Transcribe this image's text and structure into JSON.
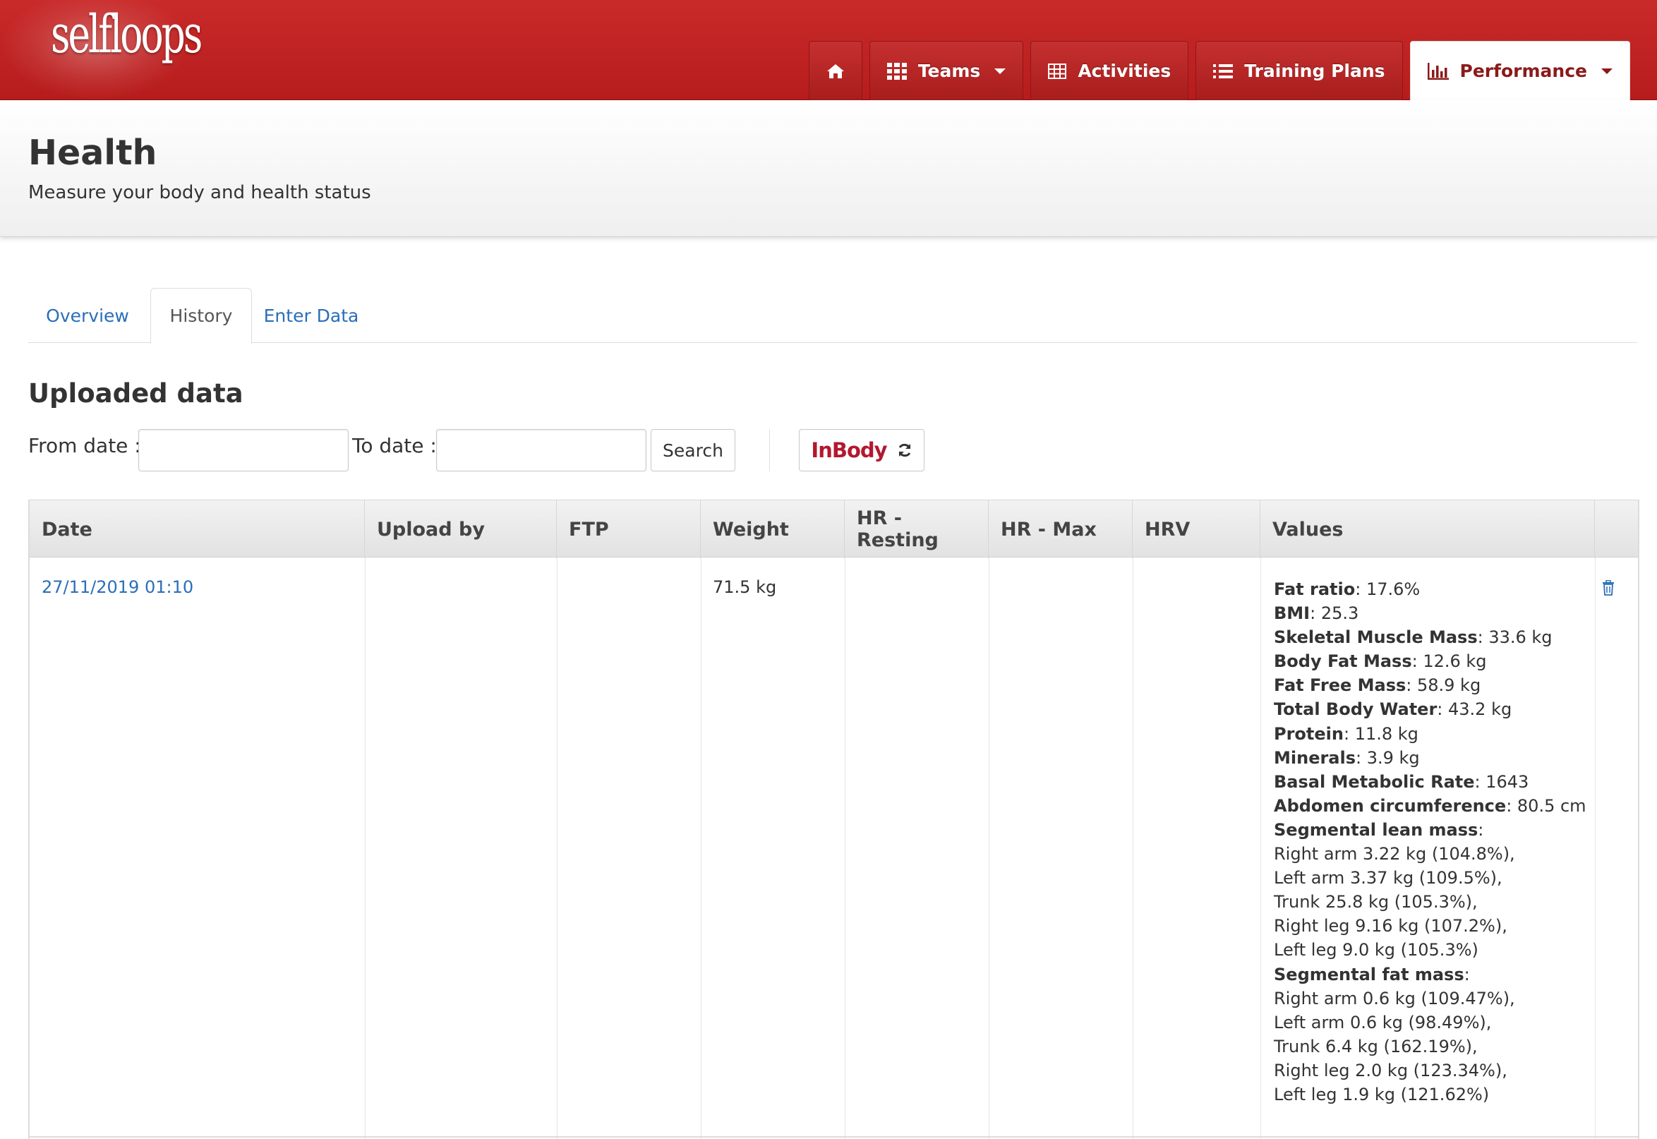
{
  "brand": {
    "logo_text": "selfloops"
  },
  "nav": {
    "home_label": "",
    "items": [
      {
        "label": "Teams",
        "icon": "grid-icon"
      },
      {
        "label": "Activities",
        "icon": "table-icon"
      },
      {
        "label": "Training Plans",
        "icon": "list-icon"
      },
      {
        "label": "Performance",
        "icon": "bar-chart-icon"
      }
    ],
    "active": "Performance",
    "accent_color": "#b71c1c"
  },
  "page": {
    "title": "Health",
    "subtitle": "Measure your body and health status"
  },
  "tabs": [
    {
      "label": "Overview"
    },
    {
      "label": "History"
    },
    {
      "label": "Enter Data"
    }
  ],
  "active_tab": "History",
  "uploaded": {
    "title": "Uploaded data",
    "from_label": "From date :",
    "to_label": "To date :",
    "from_value": "",
    "to_value": "",
    "search_label": "Search",
    "inbody_label": "InBody"
  },
  "table": {
    "headers": [
      "Date",
      "Upload by",
      "FTP",
      "Weight",
      "HR - Resting",
      "HR - Max",
      "HRV",
      "Values",
      ""
    ],
    "rows": [
      {
        "date": "27/11/2019 01:10",
        "upload_by": "",
        "ftp": "",
        "weight": "71.5 kg",
        "hr_resting": "",
        "hr_max": "",
        "hrv": "",
        "values": [
          {
            "key": "Fat ratio",
            "value": ": 17.6%"
          },
          {
            "key": "BMI",
            "value": ": 25.3"
          },
          {
            "key": "Skeletal Muscle Mass",
            "value": ": 33.6 kg"
          },
          {
            "key": "Body Fat Mass",
            "value": ": 12.6 kg"
          },
          {
            "key": "Fat Free Mass",
            "value": ": 58.9 kg"
          },
          {
            "key": "Total Body Water",
            "value": ": 43.2 kg"
          },
          {
            "key": "Protein",
            "value": ": 11.8 kg"
          },
          {
            "key": "Minerals",
            "value": ": 3.9 kg"
          },
          {
            "key": "Basal Metabolic Rate",
            "value": ": 1643"
          },
          {
            "key": "Abdomen circumference",
            "value": ": 80.5 cm"
          },
          {
            "key": "Segmental lean mass",
            "value": ":"
          },
          {
            "key": "",
            "value": "Right arm 3.22 kg (104.8%),"
          },
          {
            "key": "",
            "value": "Left arm 3.37 kg (109.5%),"
          },
          {
            "key": "",
            "value": "Trunk 25.8 kg (105.3%),"
          },
          {
            "key": "",
            "value": "Right leg 9.16 kg (107.2%),"
          },
          {
            "key": "",
            "value": "Left leg 9.0 kg (105.3%)"
          },
          {
            "key": "Segmental fat mass",
            "value": ":"
          },
          {
            "key": "",
            "value": "Right arm 0.6 kg (109.47%),"
          },
          {
            "key": "",
            "value": "Left arm 0.6 kg (98.49%),"
          },
          {
            "key": "",
            "value": "Trunk 6.4 kg (162.19%),"
          },
          {
            "key": "",
            "value": "Right leg 2.0 kg (123.34%),"
          },
          {
            "key": "",
            "value": "Left leg 1.9 kg (121.62%)"
          }
        ],
        "action_icon": "trash-icon"
      }
    ]
  }
}
